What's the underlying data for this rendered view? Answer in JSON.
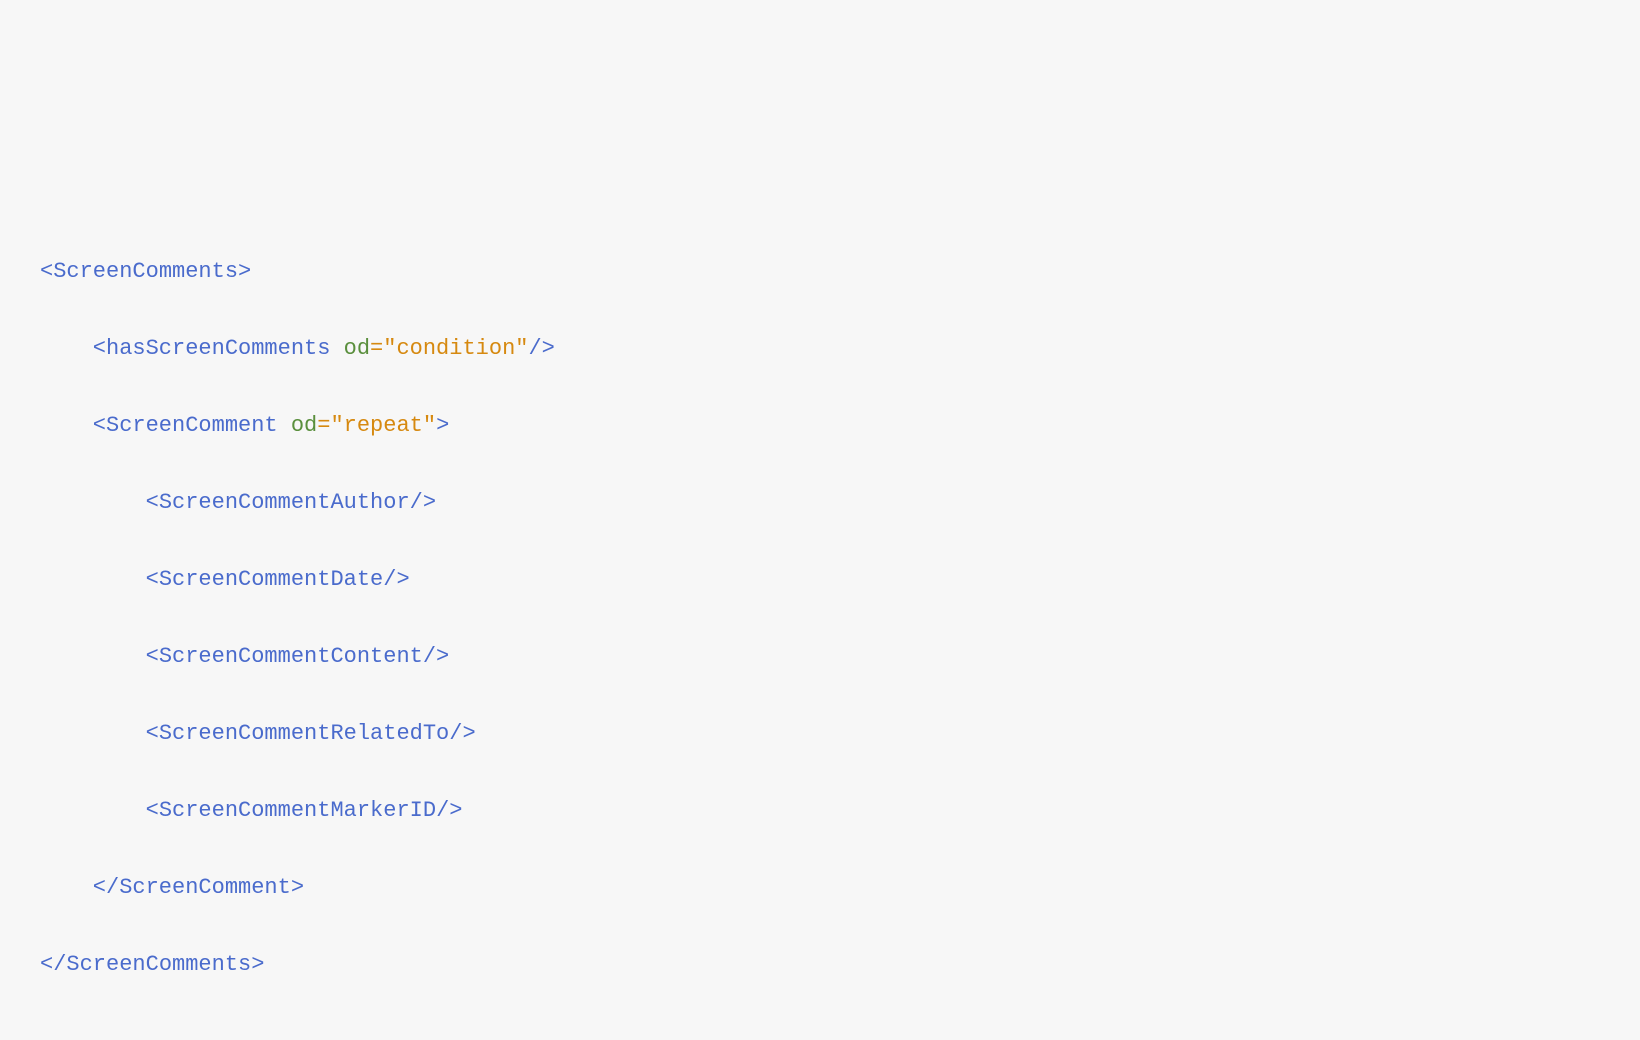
{
  "code": {
    "line1": {
      "open": "<",
      "tag": "ScreenComments",
      "close": ">"
    },
    "line2": {
      "open": "<",
      "tag": "hasScreenComments",
      "space": " ",
      "attrName": "od",
      "eq": "=",
      "q1": "\"",
      "attrValue": "condition",
      "q2": "\"",
      "close": "/>"
    },
    "line3": {
      "open": "<",
      "tag": "ScreenComment",
      "space": " ",
      "attrName": "od",
      "eq": "=",
      "q1": "\"",
      "attrValue": "repeat",
      "q2": "\"",
      "close": ">"
    },
    "line4": {
      "open": "<",
      "tag": "ScreenCommentAuthor",
      "close": "/>"
    },
    "line5": {
      "open": "<",
      "tag": "ScreenCommentDate",
      "close": "/>"
    },
    "line6": {
      "open": "<",
      "tag": "ScreenCommentContent",
      "close": "/>"
    },
    "line7": {
      "open": "<",
      "tag": "ScreenCommentRelatedTo",
      "close": "/>"
    },
    "line8": {
      "open": "<",
      "tag": "ScreenCommentMarkerID",
      "close": "/>"
    },
    "line9": {
      "open": "</",
      "tag": "ScreenComment",
      "close": ">"
    },
    "line10": {
      "open": "</",
      "tag": "ScreenComments",
      "close": ">"
    }
  }
}
